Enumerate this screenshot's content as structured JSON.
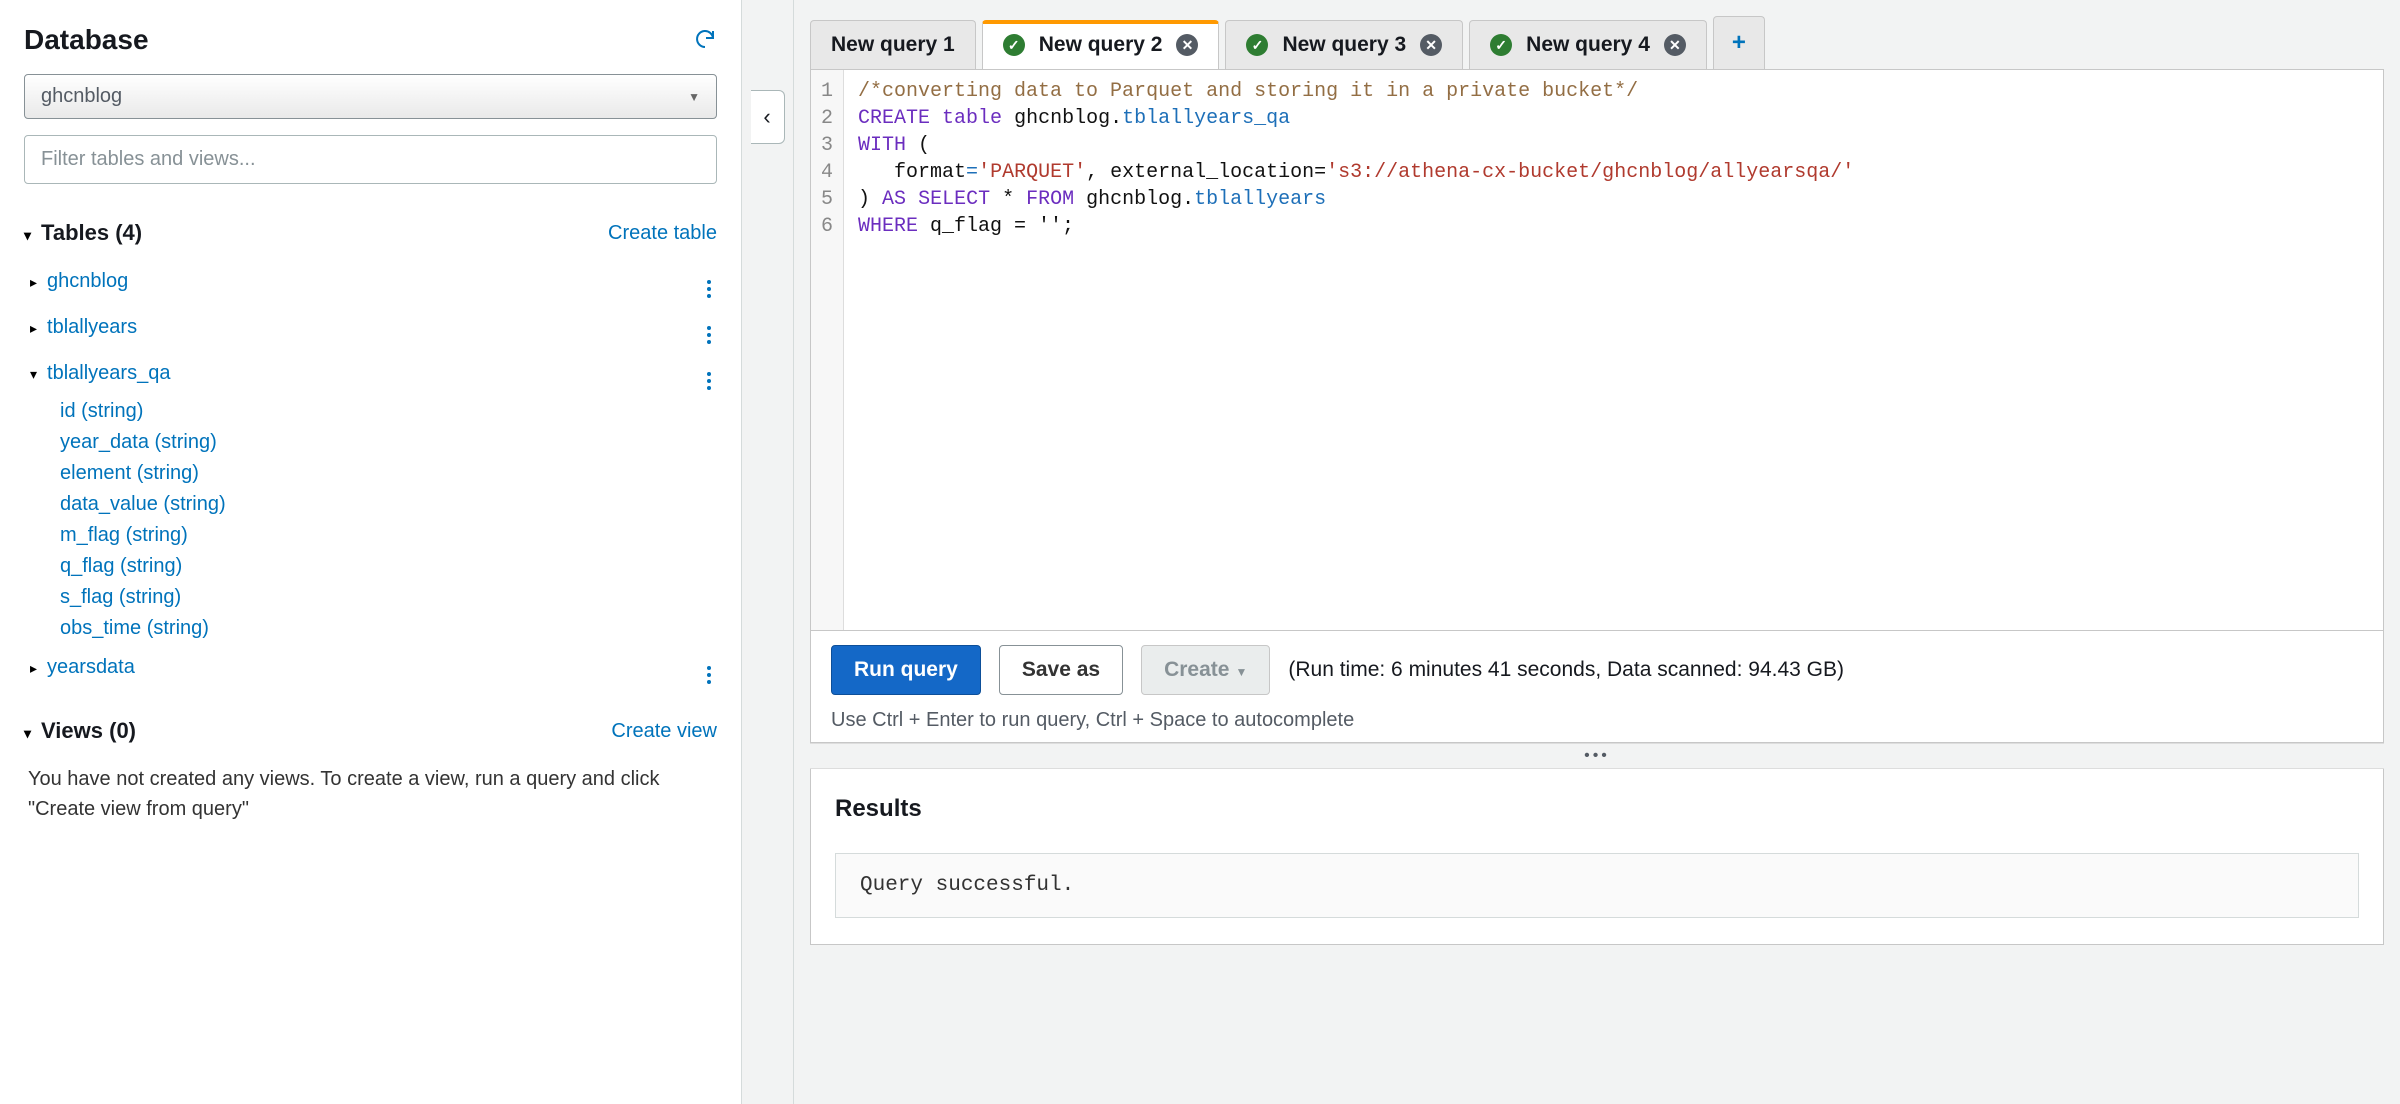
{
  "sidebar": {
    "title": "Database",
    "selected_db": "ghcnblog",
    "filter_placeholder": "Filter tables and views...",
    "tables_header": "Tables (4)",
    "create_table_label": "Create table",
    "tables": [
      {
        "name": "ghcnblog",
        "expanded": false,
        "cols": []
      },
      {
        "name": "tblallyears",
        "expanded": false,
        "cols": []
      },
      {
        "name": "tblallyears_qa",
        "expanded": true,
        "cols": [
          "id (string)",
          "year_data (string)",
          "element (string)",
          "data_value (string)",
          "m_flag (string)",
          "q_flag (string)",
          "s_flag (string)",
          "obs_time (string)"
        ]
      },
      {
        "name": "yearsdata",
        "expanded": false,
        "cols": []
      }
    ],
    "views_header": "Views (0)",
    "create_view_label": "Create view",
    "views_empty_text": "You have not created any views. To create a view, run a query and click \"Create view from query\""
  },
  "tabs": [
    {
      "label": "New query 1",
      "status": null,
      "active": false
    },
    {
      "label": "New query 2",
      "status": "ok",
      "active": true
    },
    {
      "label": "New query 3",
      "status": "ok",
      "active": false
    },
    {
      "label": "New query 4",
      "status": "ok",
      "active": false
    }
  ],
  "editor": {
    "line_count": 6,
    "sql": {
      "l1_comment": "/*converting data to Parquet and storing it in a private bucket*/",
      "l2_kw1": "CREATE",
      "l2_kw2": "table",
      "l2_ident": "ghcnblog",
      "l2_dot": ".",
      "l2_tbl": "tblallyears_qa",
      "l3_kw": "WITH",
      "l3_paren": "(",
      "l4_indent": "   ",
      "l4_key": "format",
      "l4_eq": "=",
      "l4_val": "'PARQUET'",
      "l4_sep": ", external_location=",
      "l4_loc": "'s3://athena-cx-bucket/ghcnblog/allyearsqa/'",
      "l5_close": ") ",
      "l5_kw1": "AS",
      "l5_kw2": "SELECT",
      "l5_star": " * ",
      "l5_kw3": "FROM",
      "l5_ident": " ghcnblog",
      "l5_dot": ".",
      "l5_tbl": "tblallyears",
      "l6_kw": "WHERE",
      "l6_rest": " q_flag = '';"
    }
  },
  "buttons": {
    "run": "Run query",
    "save": "Save as",
    "create": "Create"
  },
  "run_stats": "(Run time: 6 minutes 41 seconds, Data scanned: 94.43 GB)",
  "hint": "Use Ctrl + Enter to run query, Ctrl + Space to autocomplete",
  "results": {
    "header": "Results",
    "message": "Query successful."
  }
}
